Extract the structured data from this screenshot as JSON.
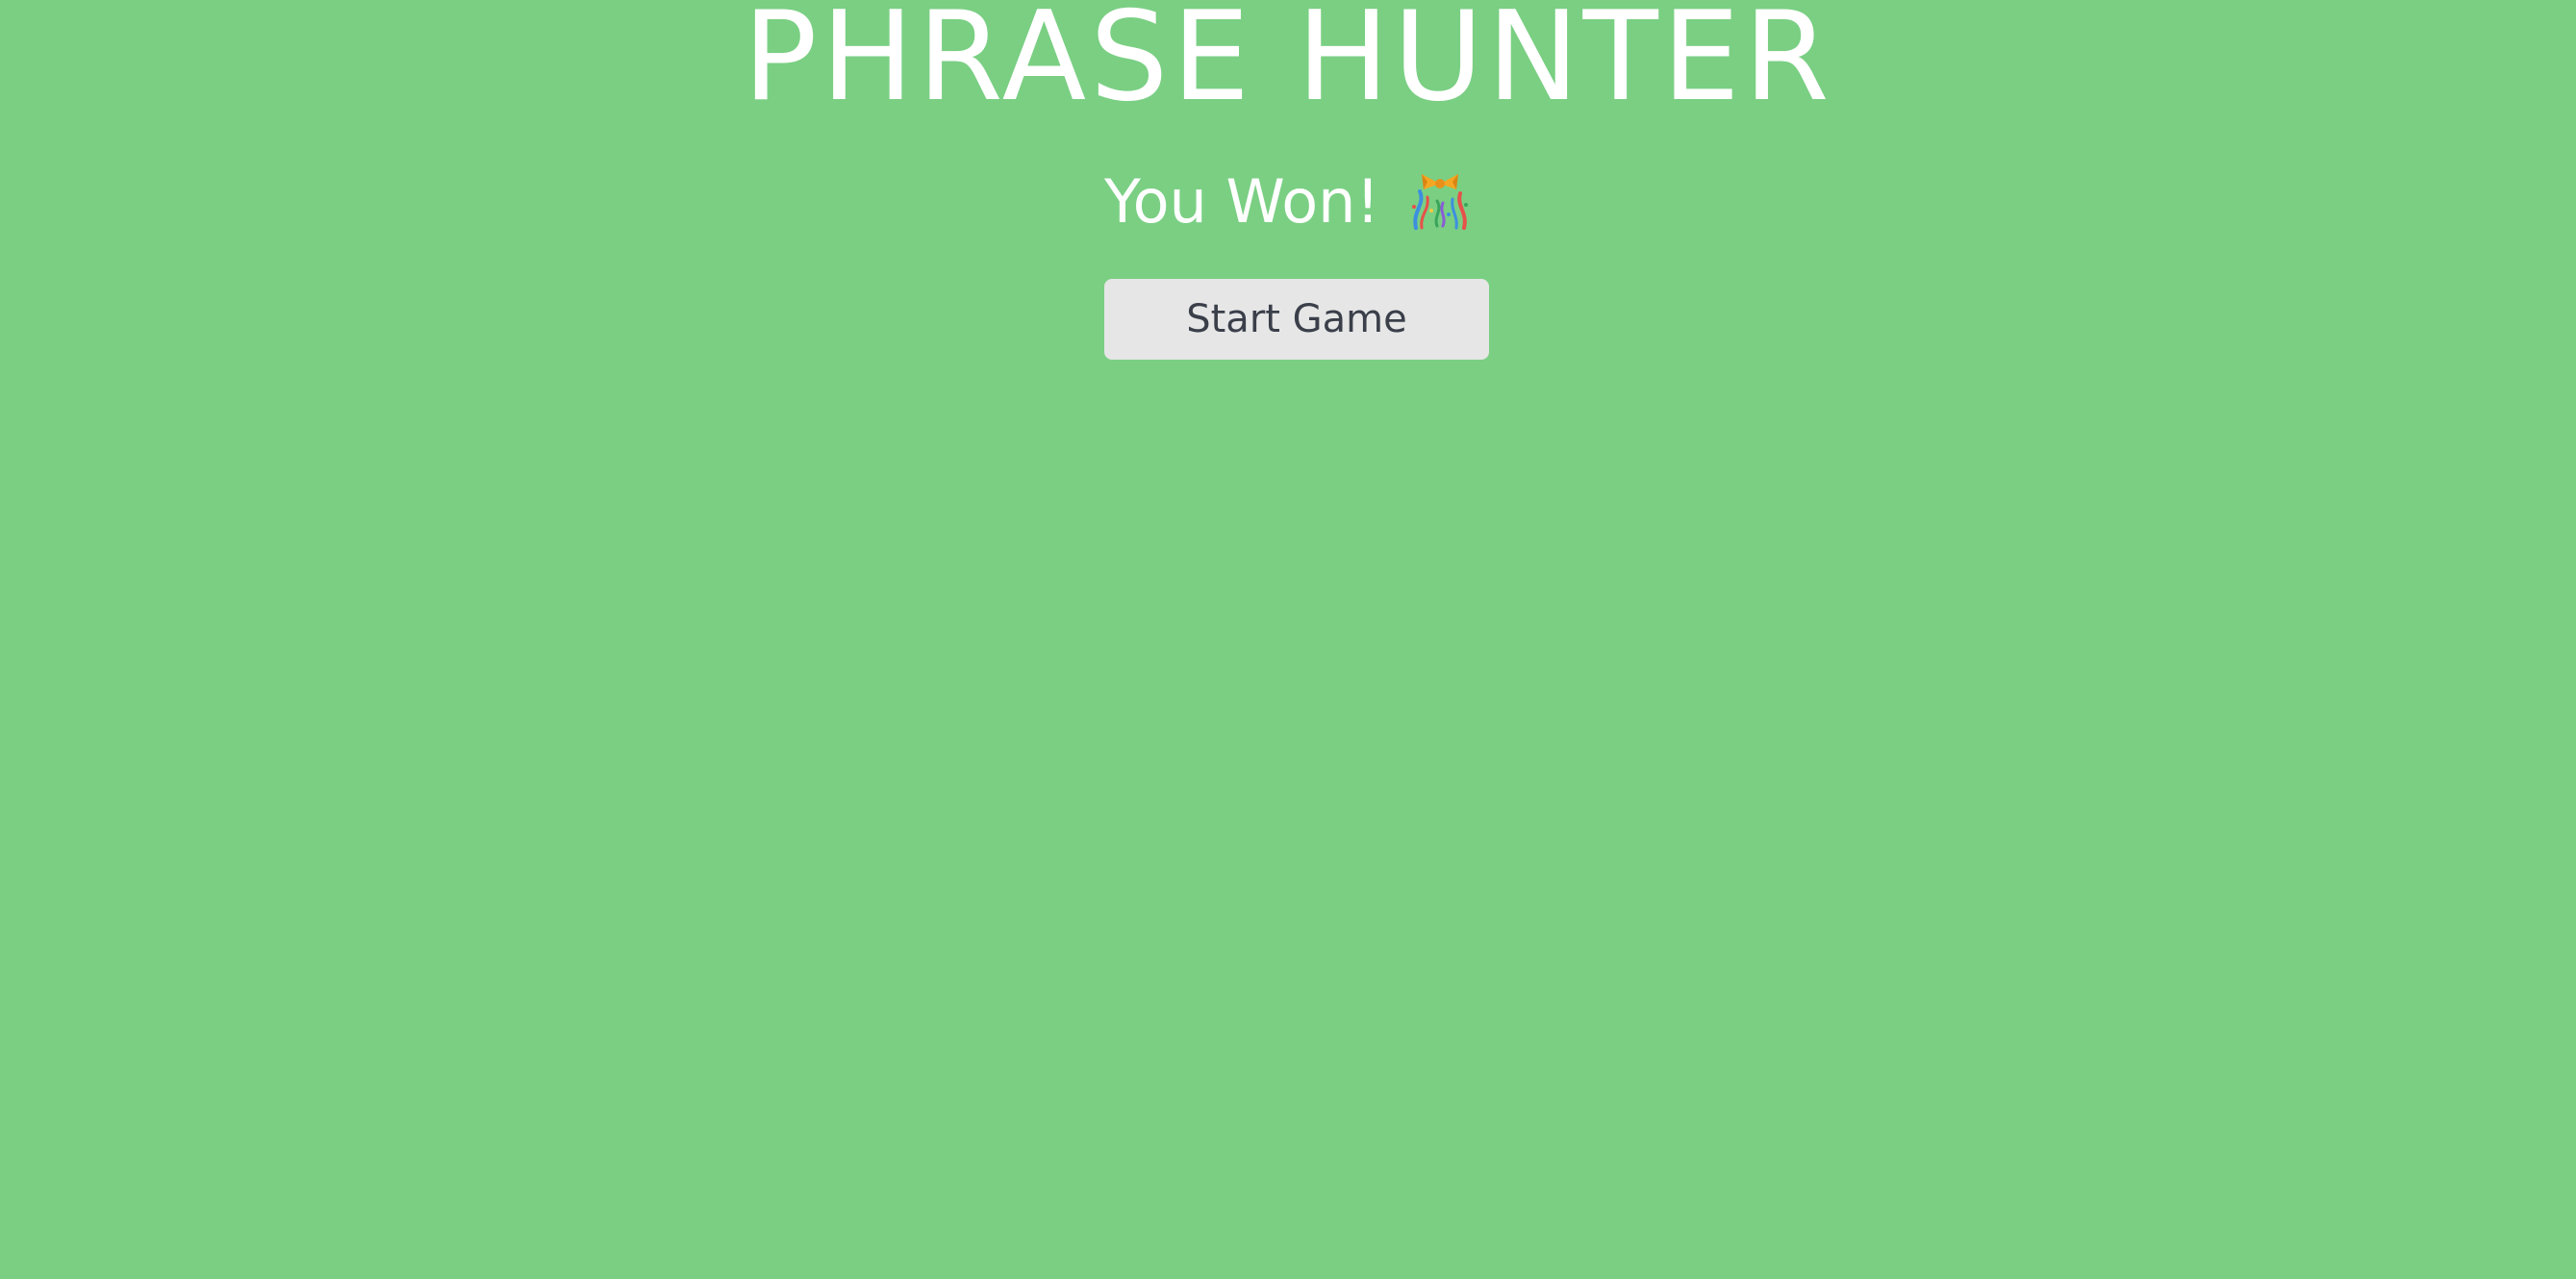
{
  "game": {
    "title": "PHRASE HUNTER",
    "result_message": "You Won!",
    "result_icon": "party-popper-icon",
    "start_button_label": "Start Game"
  },
  "colors": {
    "background": "#7acf83",
    "title_text": "#ffffff",
    "button_background": "#e6e6e6",
    "button_text": "#3a3f4a"
  }
}
